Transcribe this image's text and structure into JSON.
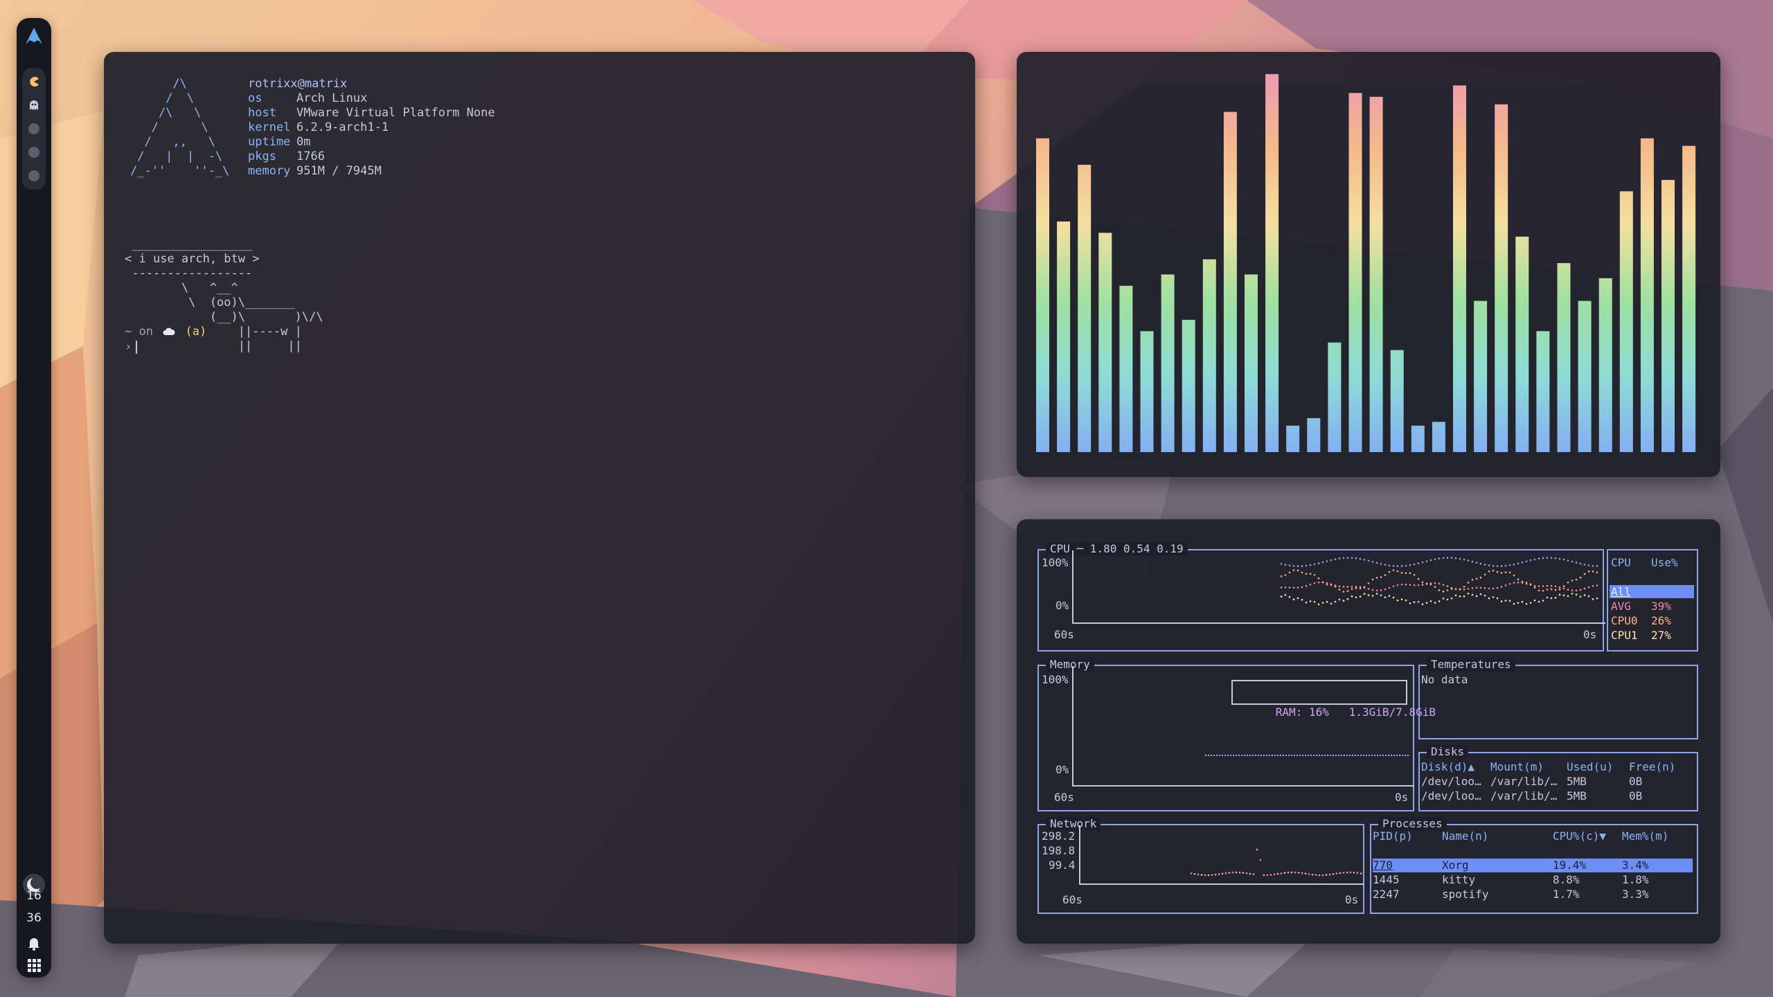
{
  "sidebar": {
    "logo_icon": "arch-logo-icon",
    "workspaces": [
      "pacman-icon",
      "ghost-icon",
      "dot",
      "dot",
      "dot"
    ],
    "clock": {
      "hour": "16",
      "minute": "36"
    },
    "tray_icons": [
      "moon-icon",
      "bell-icon",
      "grid-icon"
    ]
  },
  "terminal": {
    "logo_lines": [
      "      /\\",
      "     /  \\",
      "    /\\   \\",
      "   /      \\",
      "  /   ,,   \\",
      " /   |  |  -\\",
      "/_-''    ''-_\\"
    ],
    "fetch": {
      "user": "rotrixx@matrix",
      "rows": [
        {
          "key": "os",
          "value": "Arch Linux"
        },
        {
          "key": "host",
          "value": "VMware Virtual Platform None"
        },
        {
          "key": "kernel",
          "value": "6.2.9-arch1-1"
        },
        {
          "key": "uptime",
          "value": "0m"
        },
        {
          "key": "pkgs",
          "value": "1766"
        },
        {
          "key": "memory",
          "value": "951M / 7945M"
        }
      ]
    },
    "cowsay": [
      " _________________",
      "< i use arch, btw >",
      " -----------------",
      "        \\   ^__^",
      "         \\  (oo)\\_______",
      "            (__)\\       )\\/\\",
      "                ||----w |",
      "                ||     ||"
    ],
    "prompt": {
      "dir": "~",
      "on": "on",
      "cloud_icon": "cloud-icon",
      "git": "(a)",
      "arrow": "›"
    }
  },
  "visualizer": {
    "levels": [
      0.83,
      0.61,
      0.76,
      0.58,
      0.44,
      0.32,
      0.47,
      0.35,
      0.51,
      0.9,
      0.47,
      1.0,
      0.07,
      0.09,
      0.29,
      0.95,
      0.94,
      0.27,
      0.07,
      0.08,
      0.97,
      0.4,
      0.92,
      0.57,
      0.32,
      0.5,
      0.4,
      0.46,
      0.69,
      0.83,
      0.72,
      0.81
    ],
    "gradient": [
      "#ec9bb0",
      "#f5b98a",
      "#f3e0a0",
      "#9fe0a0",
      "#8edbd6",
      "#84aef2"
    ]
  },
  "btm": {
    "cpu": {
      "title": "CPU ─ 1.80 0.54 0.19",
      "y_top": "100%",
      "y_bottom": "0%",
      "x_left": "60s",
      "x_right": "0s",
      "legend_header": {
        "cpu": "CPU",
        "use": "Use%"
      },
      "legend": [
        {
          "name": "All",
          "use": ""
        },
        {
          "name": "AVG",
          "use": "39%"
        },
        {
          "name": "CPU0",
          "use": "26%"
        },
        {
          "name": "CPU1",
          "use": "27%"
        }
      ]
    },
    "memory": {
      "title": "Memory",
      "y_top": "100%",
      "y_bottom": "0%",
      "x_left": "60s",
      "x_right": "0s",
      "ram_label": "RAM: 16%",
      "ram_value": "1.3GiB/7.8GiB"
    },
    "temperatures": {
      "title": "Temperatures",
      "value": "No data"
    },
    "disks": {
      "title": "Disks",
      "headers": [
        "Disk(d)▲",
        "Mount(m)",
        "Used(u)",
        "Free(n)"
      ],
      "rows": [
        [
          "/dev/loo…",
          "/var/lib/…",
          "5MB",
          "0B"
        ],
        [
          "/dev/loo…",
          "/var/lib/…",
          "5MB",
          "0B"
        ]
      ]
    },
    "network": {
      "title": "Network",
      "y_labels": [
        "298.2",
        "198.8",
        "99.4"
      ],
      "x_left": "60s",
      "x_right": "0s"
    },
    "processes": {
      "title": "Processes",
      "headers": [
        "PID(p)",
        "Name(n)",
        "CPU%(c)▼",
        "Mem%(m)"
      ],
      "rows": [
        [
          "770",
          "Xorg",
          "19.4%",
          "3.4%"
        ],
        [
          "1445",
          "kitty",
          "8.8%",
          "1.8%"
        ],
        [
          "2247",
          "spotify",
          "1.7%",
          "3.3%"
        ]
      ]
    }
  }
}
